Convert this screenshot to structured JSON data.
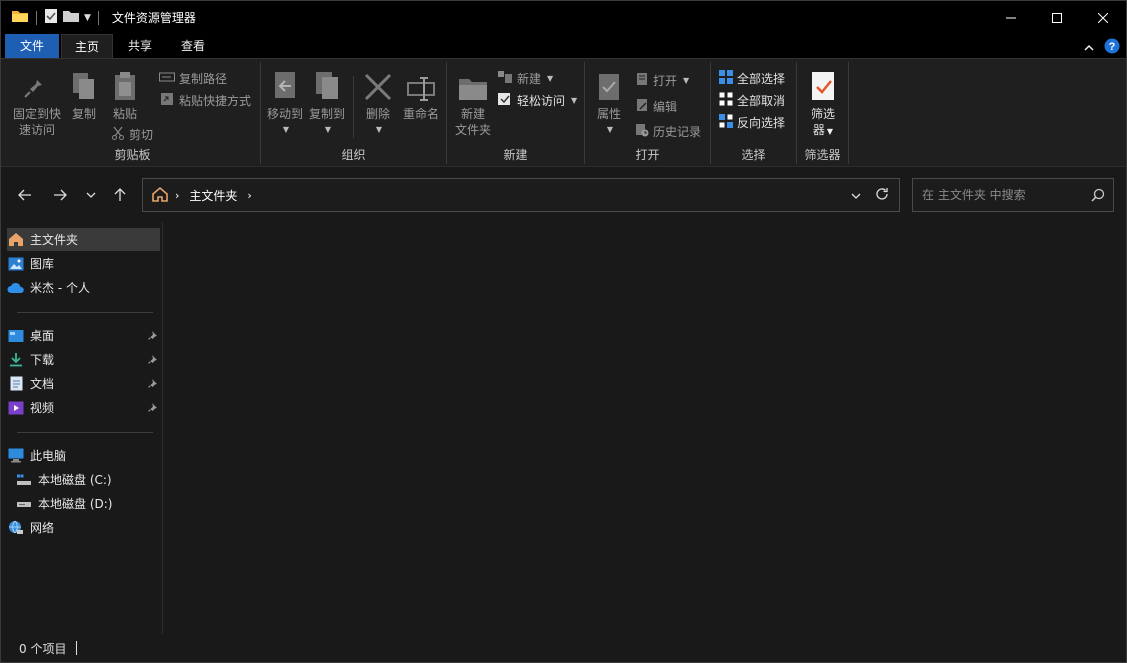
{
  "window": {
    "title": "文件资源管理器"
  },
  "tabs": {
    "file": "文件",
    "home": "主页",
    "share": "共享",
    "view": "查看"
  },
  "ribbon": {
    "clipboard": {
      "label": "剪贴板",
      "pin_line1": "固定到快",
      "pin_line2": "速访问",
      "copy": "复制",
      "paste": "粘贴",
      "copy_path": "复制路径",
      "paste_shortcut": "粘贴快捷方式",
      "cut": "剪切"
    },
    "organize": {
      "label": "组织",
      "move_to": "移动到",
      "copy_to": "复制到",
      "delete": "删除",
      "rename": "重命名"
    },
    "new": {
      "label": "新建",
      "new_folder_line1": "新建",
      "new_folder_line2": "文件夹",
      "new_item": "新建",
      "easy_access": "轻松访问"
    },
    "open": {
      "label": "打开",
      "properties": "属性",
      "open": "打开",
      "edit": "编辑",
      "history": "历史记录"
    },
    "select": {
      "label": "选择",
      "select_all": "全部选择",
      "select_none": "全部取消",
      "invert": "反向选择"
    },
    "filter": {
      "label": "筛选器",
      "filter_line1": "筛选",
      "filter_line2": "器"
    }
  },
  "address": {
    "crumb": "主文件夹"
  },
  "search": {
    "placeholder": "在 主文件夹 中搜索"
  },
  "sidebar": {
    "items": [
      {
        "label": "主文件夹",
        "icon": "home-icon"
      },
      {
        "label": "图库",
        "icon": "gallery-icon"
      },
      {
        "label": "米杰 - 个人",
        "icon": "onedrive-cloud-icon"
      },
      {
        "label": "桌面",
        "icon": "desktop-icon"
      },
      {
        "label": "下载",
        "icon": "download-icon"
      },
      {
        "label": "文档",
        "icon": "document-icon"
      },
      {
        "label": "视频",
        "icon": "video-icon"
      },
      {
        "label": "此电脑",
        "icon": "computer-icon"
      },
      {
        "label": "本地磁盘 (C:)",
        "icon": "drive-c-icon"
      },
      {
        "label": "本地磁盘 (D:)",
        "icon": "drive-d-icon"
      },
      {
        "label": "网络",
        "icon": "network-icon"
      }
    ]
  },
  "status": {
    "item_count": "0 个项目"
  },
  "colors": {
    "accent": "#1e5fb4",
    "background": "#191919",
    "titlebar": "#000000"
  }
}
